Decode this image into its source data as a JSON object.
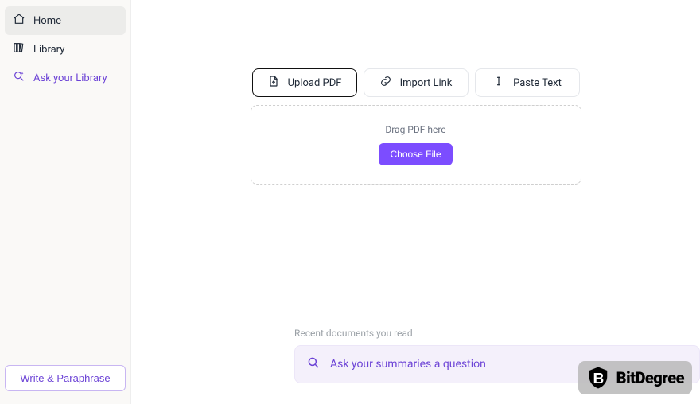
{
  "sidebar": {
    "items": [
      {
        "label": "Home"
      },
      {
        "label": "Library"
      },
      {
        "label": "Ask your Library"
      }
    ],
    "write_button": "Write & Paraphrase"
  },
  "tabs": {
    "upload": "Upload PDF",
    "import": "Import Link",
    "paste": "Paste Text"
  },
  "dropzone": {
    "hint": "Drag PDF here",
    "button": "Choose File"
  },
  "recent_label": "Recent documents you read",
  "ask_bar": {
    "placeholder": "Ask your summaries a question"
  },
  "brand": {
    "name": "BitDegree"
  }
}
